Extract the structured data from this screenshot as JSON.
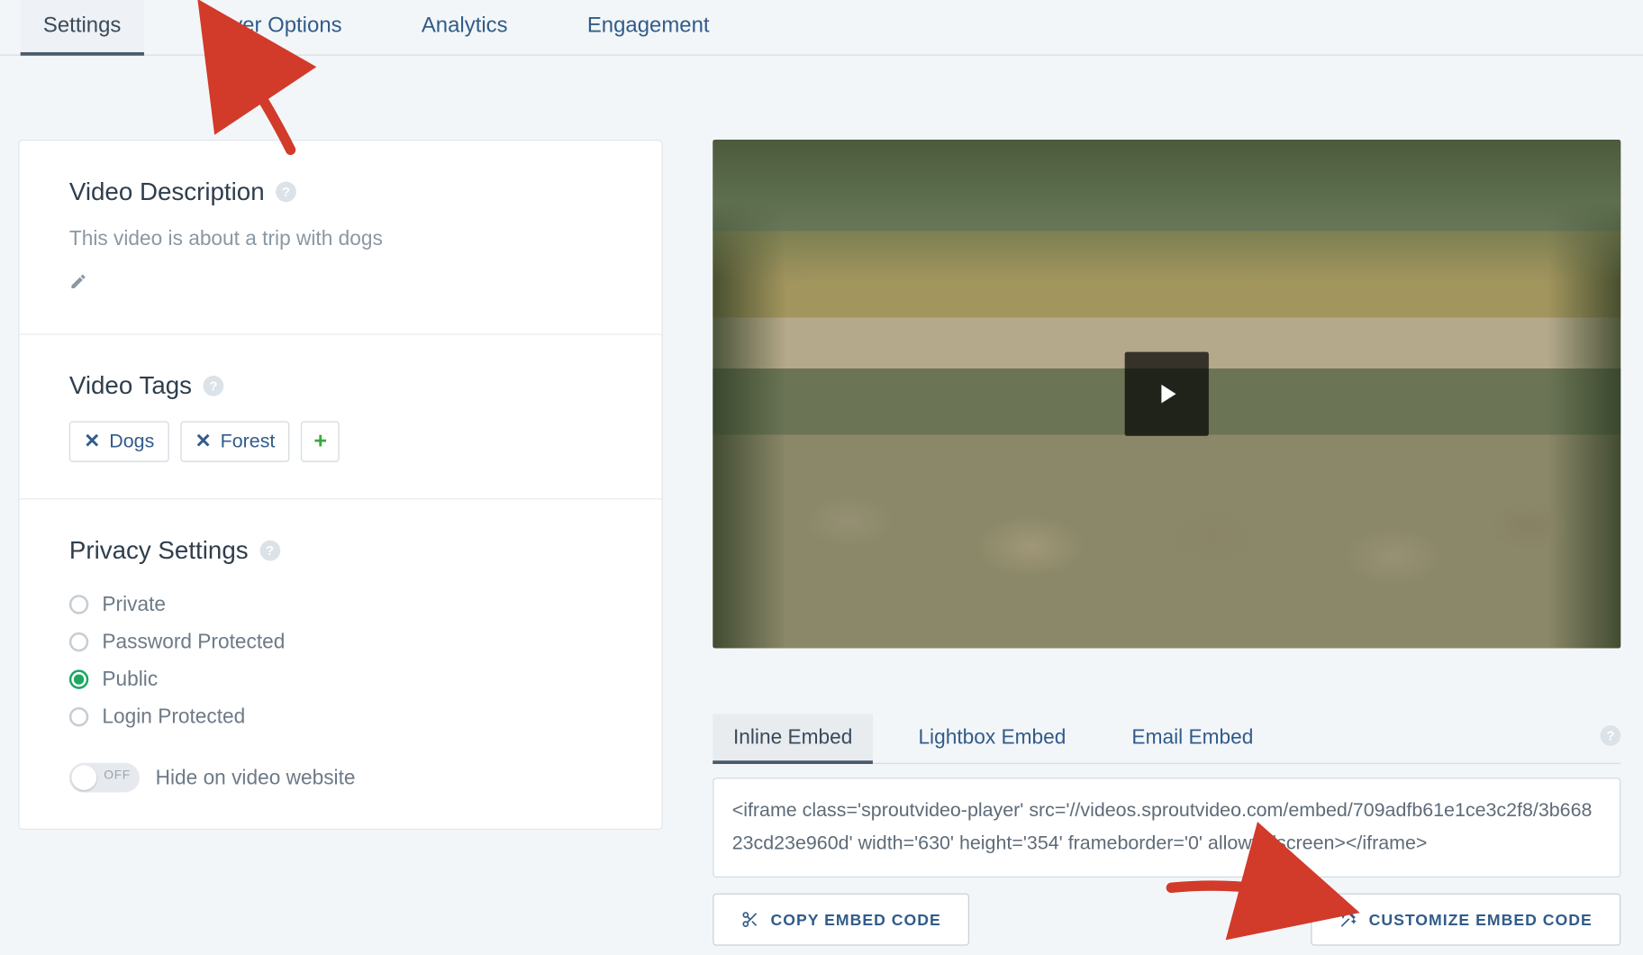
{
  "tabs": {
    "items": [
      {
        "label": "Settings",
        "active": true
      },
      {
        "label": "Player Options",
        "active": false
      },
      {
        "label": "Analytics",
        "active": false
      },
      {
        "label": "Engagement",
        "active": false
      }
    ]
  },
  "description": {
    "title": "Video Description",
    "text": "This video is about a trip with dogs"
  },
  "tags": {
    "title": "Video Tags",
    "items": [
      "Dogs",
      "Forest"
    ]
  },
  "privacy": {
    "title": "Privacy Settings",
    "options": [
      {
        "label": "Private",
        "selected": false
      },
      {
        "label": "Password Protected",
        "selected": false
      },
      {
        "label": "Public",
        "selected": true
      },
      {
        "label": "Login Protected",
        "selected": false
      }
    ],
    "hide_toggle": {
      "state": "OFF",
      "label": "Hide on video website"
    }
  },
  "embed": {
    "tabs": [
      {
        "label": "Inline Embed",
        "active": true
      },
      {
        "label": "Lightbox Embed",
        "active": false
      },
      {
        "label": "Email Embed",
        "active": false
      }
    ],
    "code": "<iframe class='sproutvideo-player' src='//videos.sproutvideo.com/embed/709adfb61e1ce3c2f8/3b66823cd23e960d' width='630' height='354' frameborder='0' allowfullscreen></iframe>",
    "copy_label": "COPY EMBED CODE",
    "customize_label": "CUSTOMIZE EMBED CODE"
  }
}
